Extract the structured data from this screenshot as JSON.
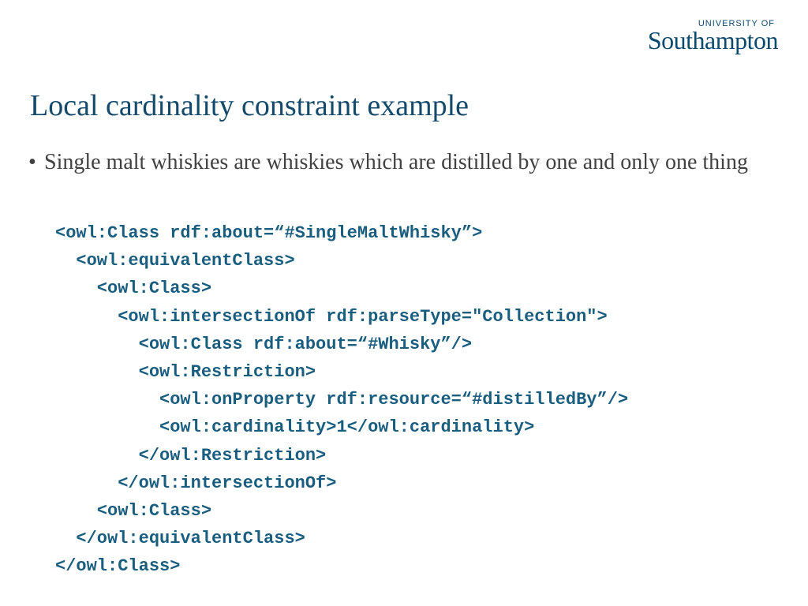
{
  "logo": {
    "top": "UNIVERSITY OF",
    "main": "Southampton"
  },
  "title": "Local cardinality constraint example",
  "bullet": "Single malt whiskies are whiskies which are distilled by one and only one thing",
  "code": {
    "l1": "<owl:Class rdf:about=“#SingleMaltWhisky”>",
    "l2": "  <owl:equivalentClass>",
    "l3": "    <owl:Class>",
    "l4": "      <owl:intersectionOf rdf:parseType=\"Collection\">",
    "l5": "        <owl:Class rdf:about=“#Whisky”/>",
    "l6": "        <owl:Restriction>",
    "l7": "          <owl:onProperty rdf:resource=“#distilledBy”/>",
    "l8": "          <owl:cardinality>1</owl:cardinality>",
    "l9": "        </owl:Restriction>",
    "l10": "      </owl:intersectionOf>",
    "l11": "    <owl:Class>",
    "l12": "  </owl:equivalentClass>",
    "l13": "</owl:Class>"
  }
}
